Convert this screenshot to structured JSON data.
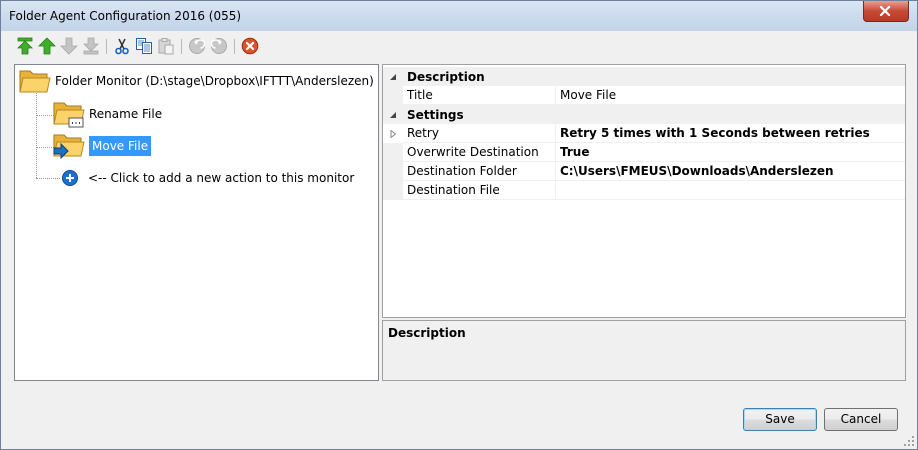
{
  "window": {
    "title": "Folder Agent Configuration 2016 (055)"
  },
  "toolbar": {
    "buttons": [
      {
        "name": "move-top-icon",
        "enabled": true
      },
      {
        "name": "move-up-icon",
        "enabled": true
      },
      {
        "name": "move-down-icon",
        "enabled": false
      },
      {
        "name": "move-bottom-icon",
        "enabled": false
      },
      {
        "name": "cut-icon",
        "enabled": true
      },
      {
        "name": "copy-icon",
        "enabled": true
      },
      {
        "name": "paste-icon",
        "enabled": false
      },
      {
        "name": "undo-icon",
        "enabled": false
      },
      {
        "name": "redo-icon",
        "enabled": false
      },
      {
        "name": "delete-icon",
        "enabled": true
      }
    ]
  },
  "tree": {
    "root_label": "Folder Monitor (D:\\stage\\Dropbox\\IFTTT\\Anderslezen)",
    "items": [
      {
        "label": "Rename File",
        "selected": false
      },
      {
        "label": "Move File",
        "selected": true
      }
    ],
    "add_label": "<-- Click to add a new action to this monitor"
  },
  "properties": {
    "description_category": "Description",
    "title_name": "Title",
    "title_value": "Move File",
    "settings_category": "Settings",
    "retry_name": "Retry",
    "retry_value": "Retry 5 times with 1 Seconds between retries",
    "overwrite_name": "Overwrite Destination",
    "overwrite_value": "True",
    "dest_folder_name": "Destination Folder",
    "dest_folder_value": "C:\\Users\\FMEUS\\Downloads\\Anderslezen",
    "dest_file_name": "Destination File",
    "dest_file_value": ""
  },
  "description_panel": {
    "title": "Description"
  },
  "buttons": {
    "save": "Save",
    "cancel": "Cancel"
  },
  "colors": {
    "selection": "#3399ff",
    "arrow_green": "#3fae29",
    "delete_red": "#d9532c"
  }
}
